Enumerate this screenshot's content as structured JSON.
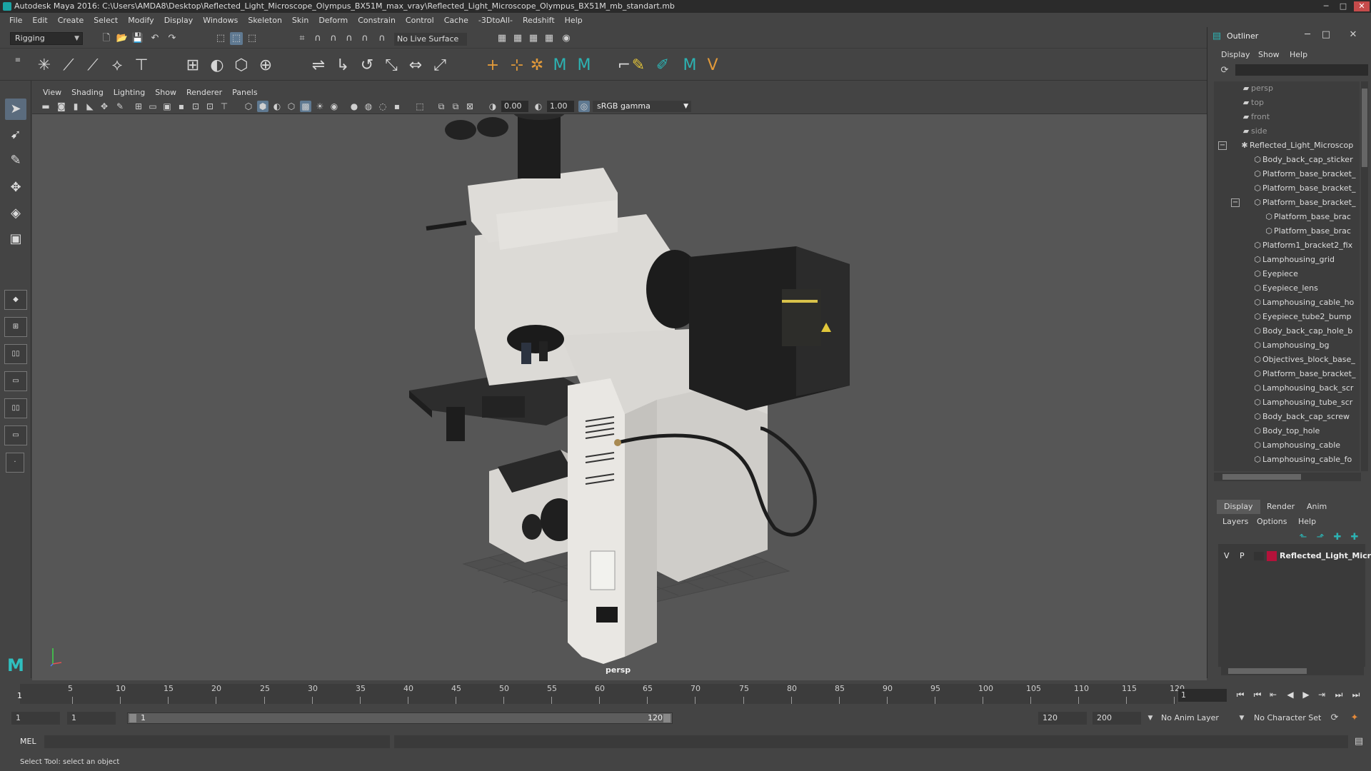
{
  "window": {
    "title": "Autodesk Maya 2016: C:\\Users\\AMDA8\\Desktop\\Reflected_Light_Microscope_Olympus_BX51M_max_vray\\Reflected_Light_Microscope_Olympus_BX51M_mb_standart.mb",
    "minimize": "─",
    "maximize": "□",
    "close": "✕"
  },
  "menubar": [
    "File",
    "Edit",
    "Create",
    "Select",
    "Modify",
    "Display",
    "Windows",
    "Skeleton",
    "Skin",
    "Deform",
    "Constrain",
    "Control",
    "Cache",
    "-3DtoAll-",
    "Redshift",
    "Help"
  ],
  "statusline": {
    "mode": "Rigging",
    "live_surface": "No Live Surface"
  },
  "viewport": {
    "menu": [
      "View",
      "Shading",
      "Lighting",
      "Show",
      "Renderer",
      "Panels"
    ],
    "exposure": "0.00",
    "gamma": "1.00",
    "color_space": "sRGB gamma",
    "camera": "persp"
  },
  "timeline": {
    "ticks": [
      "5",
      "10",
      "15",
      "20",
      "25",
      "30",
      "35",
      "40",
      "45",
      "50",
      "55",
      "60",
      "65",
      "70",
      "75",
      "80",
      "85",
      "90",
      "95",
      "100",
      "105",
      "110",
      "115",
      "120"
    ],
    "current_frame_marker": "1",
    "current_frame": "1"
  },
  "range": {
    "start": "1",
    "playback_start": "1",
    "slider_start": "1",
    "slider_end": "120",
    "playback_end": "120",
    "end": "200",
    "anim_layer": "No Anim Layer",
    "character_set": "No Character Set"
  },
  "command": {
    "language": "MEL",
    "help": "Select Tool: select an object"
  },
  "outliner": {
    "title": "Outliner",
    "menu": [
      "Display",
      "Show",
      "Help"
    ],
    "items": [
      {
        "label": "persp",
        "type": "camera"
      },
      {
        "label": "top",
        "type": "camera"
      },
      {
        "label": "front",
        "type": "camera"
      },
      {
        "label": "side",
        "type": "camera"
      },
      {
        "label": "Reflected_Light_Microscop",
        "type": "group"
      },
      {
        "label": "Body_back_cap_sticker",
        "type": "mesh"
      },
      {
        "label": "Platform_base_bracket_",
        "type": "mesh"
      },
      {
        "label": "Platform_base_bracket_",
        "type": "mesh"
      },
      {
        "label": "Platform_base_bracket_",
        "type": "mesh"
      },
      {
        "label": "Platform_base_brac",
        "type": "mesh"
      },
      {
        "label": "Platform_base_brac",
        "type": "mesh"
      },
      {
        "label": "Platform1_bracket2_fix",
        "type": "mesh"
      },
      {
        "label": "Lamphousing_grid",
        "type": "mesh"
      },
      {
        "label": "Eyepiece",
        "type": "mesh"
      },
      {
        "label": "Eyepiece_lens",
        "type": "mesh"
      },
      {
        "label": "Lamphousing_cable_ho",
        "type": "mesh"
      },
      {
        "label": "Eyepiece_tube2_bump",
        "type": "mesh"
      },
      {
        "label": "Body_back_cap_hole_b",
        "type": "mesh"
      },
      {
        "label": "Lamphousing_bg",
        "type": "mesh"
      },
      {
        "label": "Objectives_block_base_",
        "type": "mesh"
      },
      {
        "label": "Platform_base_bracket_",
        "type": "mesh"
      },
      {
        "label": "Lamphousing_back_scr",
        "type": "mesh"
      },
      {
        "label": "Lamphousing_tube_scr",
        "type": "mesh"
      },
      {
        "label": "Body_back_cap_screw",
        "type": "mesh"
      },
      {
        "label": "Body_top_hole",
        "type": "mesh"
      },
      {
        "label": "Lamphousing_cable",
        "type": "mesh"
      },
      {
        "label": "Lamphousing_cable_fo",
        "type": "mesh"
      }
    ]
  },
  "layers": {
    "tabs": [
      "Display",
      "Render",
      "Anim"
    ],
    "menu": [
      "Layers",
      "Options",
      "Help"
    ],
    "row": {
      "visible": "V",
      "playback": "P",
      "name": "Reflected_Light_Micro",
      "color": "#b3123a"
    }
  },
  "colors": {
    "accent_selected": "#5f7991",
    "maya_teal": "#2cb3b3"
  }
}
